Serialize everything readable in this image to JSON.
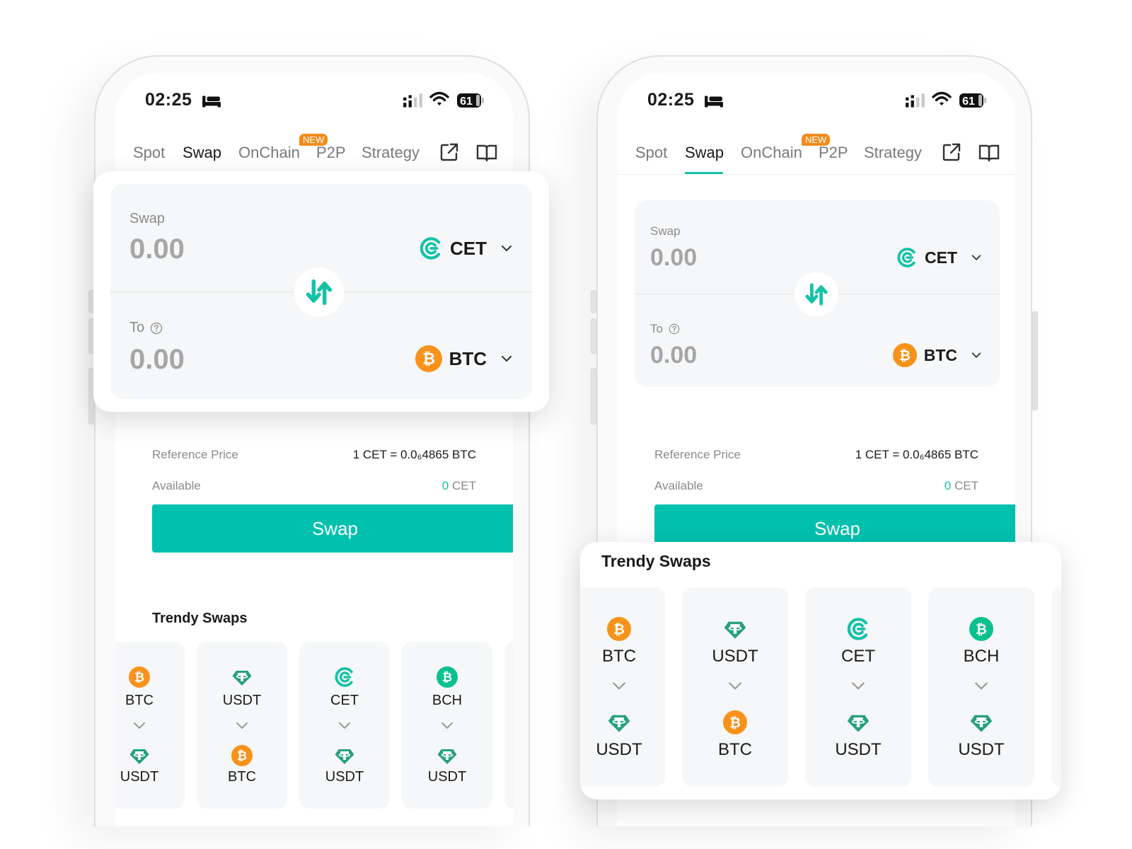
{
  "status": {
    "time": "02:25",
    "battery": "61"
  },
  "tabs": [
    {
      "label": "Spot"
    },
    {
      "label": "Swap"
    },
    {
      "label": "OnChain"
    },
    {
      "label": "P2P"
    },
    {
      "label": "Strategy"
    }
  ],
  "new_badge": "NEW",
  "swap": {
    "from_label": "Swap",
    "from_amount": "0.00",
    "from_coin": "CET",
    "to_label": "To",
    "to_amount": "0.00",
    "to_coin": "BTC"
  },
  "info": {
    "ref_label": "Reference Price",
    "ref_value": "1 CET  =  0.0₆4865 BTC",
    "avail_label": "Available",
    "avail_amount": "0",
    "avail_coin": "CET"
  },
  "swap_button": "Swap",
  "trendy": {
    "title": "Trendy Swaps",
    "pairs": [
      {
        "from": "BTC",
        "to": "USDT"
      },
      {
        "from": "USDT",
        "to": "BTC"
      },
      {
        "from": "CET",
        "to": "USDT"
      },
      {
        "from": "BCH",
        "to": "USDT"
      }
    ]
  },
  "colors": {
    "accent": "#14c2a8",
    "button": "#00c1ae",
    "btc": "#f7931a",
    "usdt": "#26a17b",
    "bch": "#0ac18e",
    "badge": "#f28c1a"
  }
}
